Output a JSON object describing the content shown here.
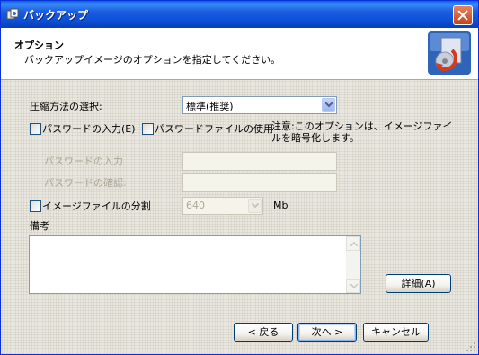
{
  "window": {
    "title": "バックアップ"
  },
  "header": {
    "title": "オプション",
    "subtitle": "バックアップイメージのオプションを指定してください。"
  },
  "compression": {
    "label": "圧縮方法の選択:",
    "value": "標準(推奨)"
  },
  "password_checkbox": {
    "label": "パスワードの入力(E)",
    "checked": false
  },
  "password_file_checkbox": {
    "label": "パスワードファイルの使用",
    "checked": false
  },
  "note": {
    "line1": "注意:このオプションは、イメージファイ",
    "line2": "ルを暗号化します。"
  },
  "password_field": {
    "label": "パスワードの入力",
    "value": ""
  },
  "password_confirm_field": {
    "label": "パスワードの確認:",
    "value": ""
  },
  "split": {
    "label": "イメージファイルの分割",
    "checked": false,
    "value": "640",
    "unit": "Mb"
  },
  "remarks": {
    "label": "備考",
    "value": ""
  },
  "buttons": {
    "details": "詳細(A)",
    "back": "< 戻る",
    "next": "次へ >",
    "cancel": "キャンセル"
  }
}
